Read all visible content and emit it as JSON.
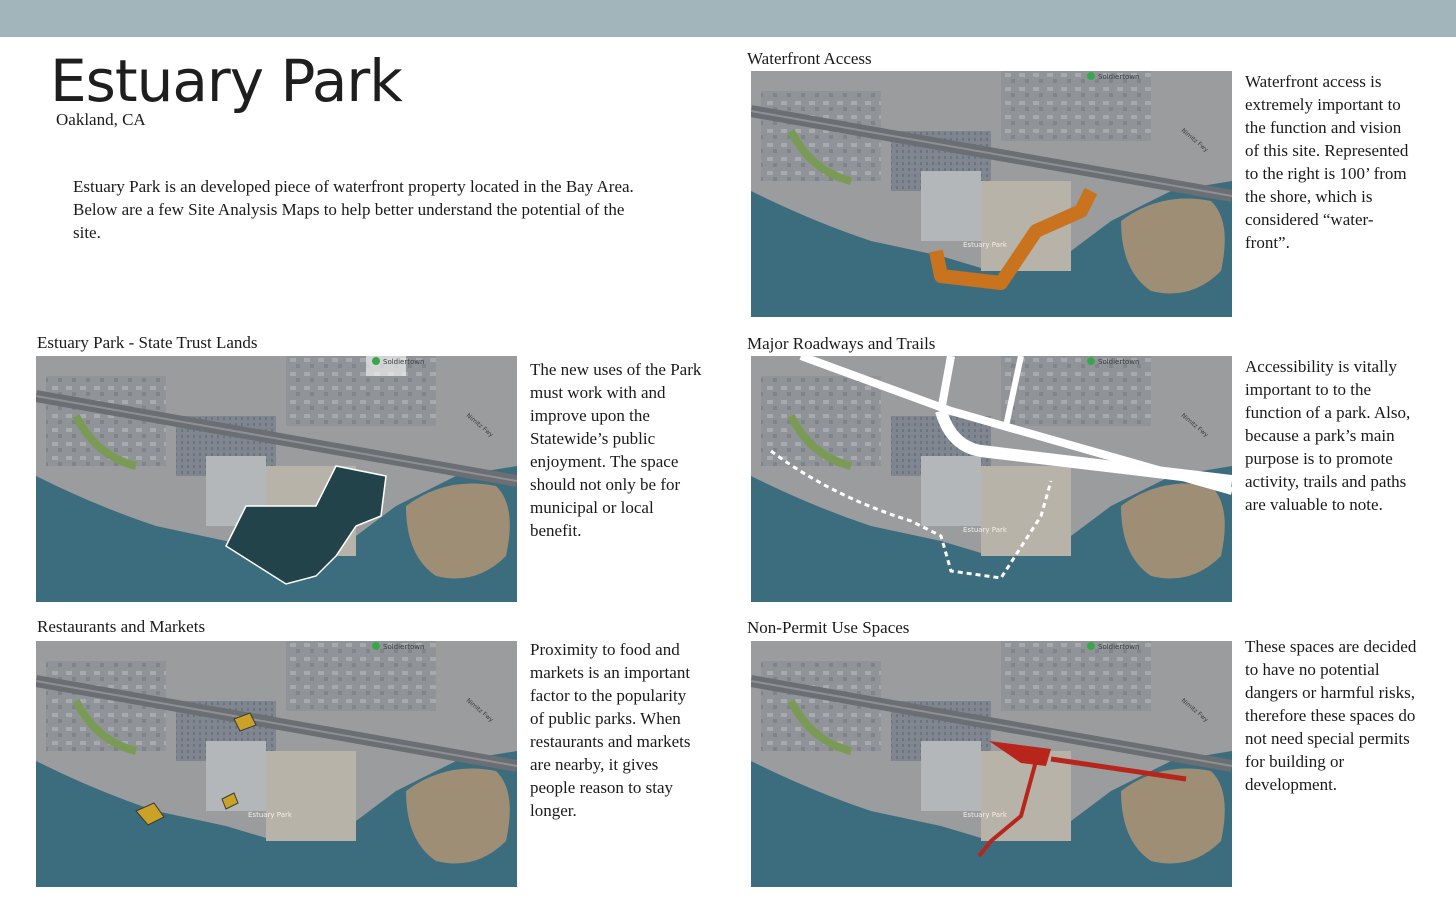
{
  "header": {
    "title": "Estuary Park",
    "location": "Oakland, CA"
  },
  "intro": {
    "p1": "Estuary Park is an developed piece of  waterfront property located in the Bay Area.",
    "p2": "Below are a few Site Analysis Maps to help better understand the potential of  the site."
  },
  "map_labels": {
    "place": "Estuary Park",
    "poi": "Soldiertown",
    "road": "Nimitz Fwy"
  },
  "sections": {
    "state_trust": {
      "title": "Estuary Park - State Trust Lands",
      "text": "The new uses of  the Park must work with and improve upon the Statewide’s public enjoyment. The space should not only be for municipal or local benefit.",
      "overlay_color": "#22434a"
    },
    "restaurants": {
      "title": "Restaurants and Markets",
      "text": "Proximity to food and markets is an important factor to the popularity of public parks. When restaurants and markets are nearby, it gives people reason to stay longer.",
      "overlay_color": "#c9a227"
    },
    "waterfront": {
      "title": "Waterfront Access",
      "text": "Waterfront access is extremely important to the function and vision of  this site. Represented to the right is 100’ from the shore, which is considered “water-front”.",
      "overlay_color": "#c9731f"
    },
    "roadways": {
      "title": "Major Roadways and Trails",
      "text": "Accessibility is vitally important to to the function of  a park. Also, because a park’s main purpose is to promote activity, trails and paths are valuable to note.",
      "overlay_color": "#ffffff"
    },
    "non_permit": {
      "title": "Non-Permit Use Spaces",
      "text": "These spaces are decided to have no potential dangers or harmful risks, therefore these spaces do not need special permits for building or development.",
      "overlay_color": "#b8251a"
    }
  }
}
